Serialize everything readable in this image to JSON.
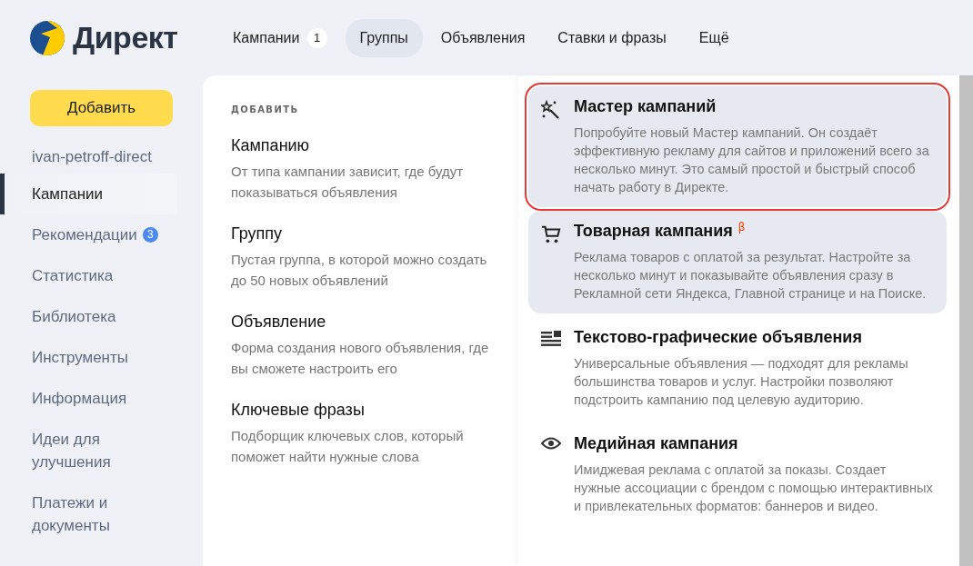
{
  "logo": {
    "text": "Директ"
  },
  "nav": [
    {
      "label": "Кампании",
      "badge": "1",
      "selected": false
    },
    {
      "label": "Группы",
      "selected": true
    },
    {
      "label": "Объявления",
      "selected": false
    },
    {
      "label": "Ставки и фразы",
      "selected": false
    },
    {
      "label": "Ещё",
      "selected": false
    }
  ],
  "sidebar": {
    "add_button": "Добавить",
    "account": "ivan-petroff-direct",
    "items": [
      {
        "label": "Кампании",
        "selected": true
      },
      {
        "label": "Рекомендации",
        "badge": "3",
        "selected": false
      },
      {
        "label": "Статистика",
        "selected": false
      },
      {
        "label": "Библиотека",
        "selected": false
      },
      {
        "label": "Инструменты",
        "selected": false
      },
      {
        "label": "Информация",
        "selected": false
      },
      {
        "label": "Идеи для улучшения",
        "selected": false
      },
      {
        "label": "Платежи и документы",
        "selected": false
      }
    ]
  },
  "add_menu": {
    "heading": "ДОБАВИТЬ",
    "items": [
      {
        "title": "Кампанию",
        "description": "От типа кампании зависит, где будут показываться объявления"
      },
      {
        "title": "Группу",
        "description": "Пустая группа, в которой можно создать до 50 новых объявлений"
      },
      {
        "title": "Объявление",
        "description": "Форма создания нового объявления, где вы сможете настроить его"
      },
      {
        "title": "Ключевые фразы",
        "description": "Подборщик ключевых слов, который поможет найти нужные слова"
      }
    ]
  },
  "campaign_types": [
    {
      "kind": "wand",
      "title": "Мастер кампаний",
      "description": "Попробуйте новый Мастер кампаний. Он создаёт эффективную рекламу для сайтов и приложений всего за несколько минут. Это самый простой и быстрый способ начать работу в Директе.",
      "shaded": true,
      "outlined": true
    },
    {
      "kind": "cart",
      "title": "Товарная кампания",
      "badge": "β",
      "description": "Реклама товаров с оплатой за результат. Настройте за несколько минут и показывайте объявления сразу в Рекламной сети Яндекса, Главной странице и на Поиске.",
      "shaded": true,
      "outlined": false
    },
    {
      "kind": "text-graphic",
      "title": "Текстово-графические объявления",
      "description": "Универсальные объявления — подходят для рекламы большинства товаров и услуг. Настройки позволяют подстроить кампанию под целевую аудиторию.",
      "shaded": false,
      "outlined": false
    },
    {
      "kind": "eye",
      "title": "Медийная кампания",
      "description": "Имиджевая реклама с оплатой за показы. Создает нужные ассоциации с брендом с помощью интерактивных и привлекательных форматов: баннеров и видео.",
      "shaded": false,
      "outlined": false
    }
  ]
}
